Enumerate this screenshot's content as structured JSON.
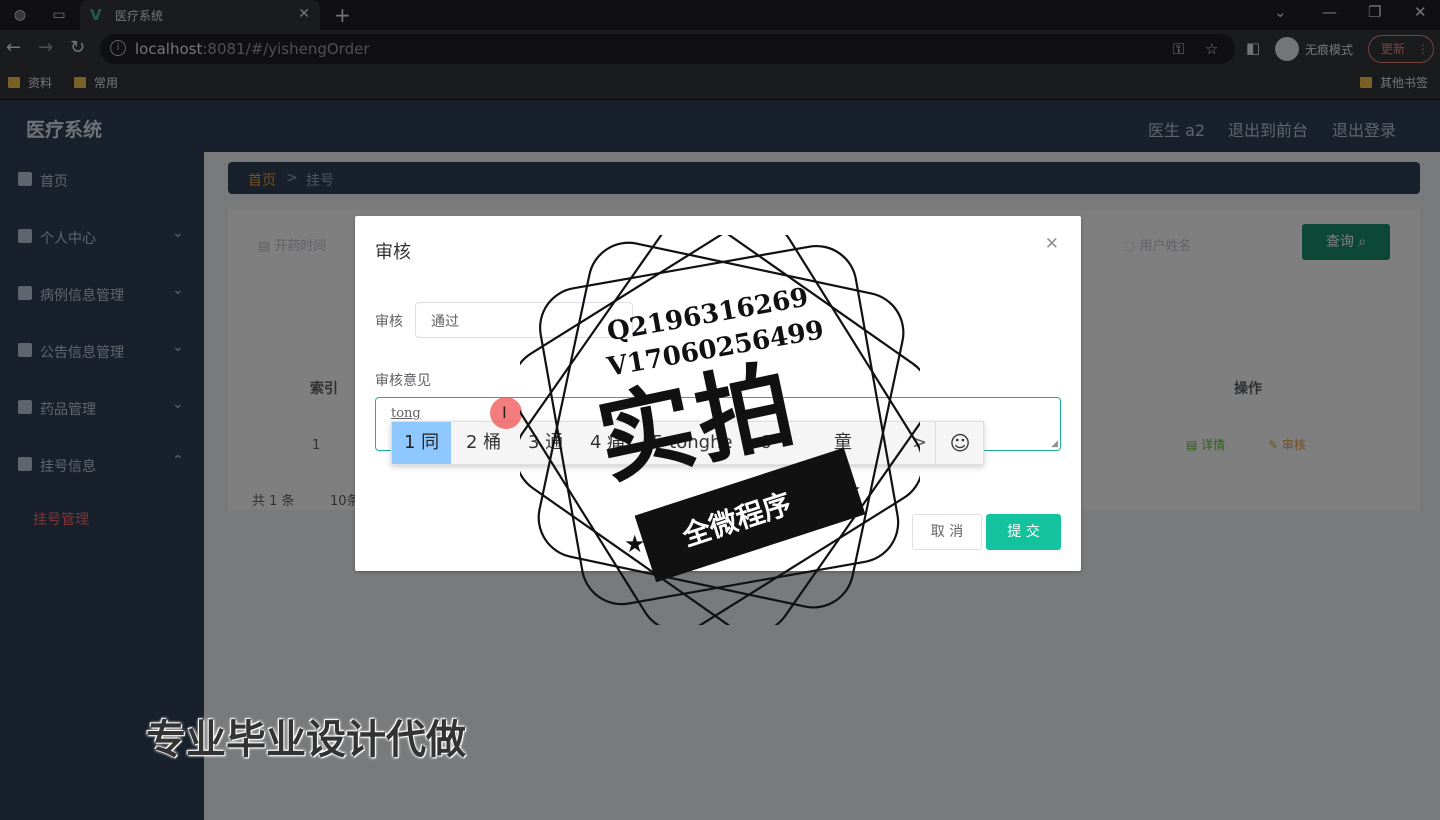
{
  "browser": {
    "tab_title": "医疗系统",
    "url_host": "localhost",
    "url_rest": ":8081/#/yishengOrder",
    "incognito_label": "无痕模式",
    "update_label": "更新",
    "bookmarks": [
      "资料",
      "常用"
    ],
    "other_bookmarks": "其他书签"
  },
  "app": {
    "title": "医疗系统",
    "header_links": [
      "医生 a2",
      "退出到前台",
      "退出登录"
    ],
    "sidebar": {
      "items": [
        {
          "label": "首页",
          "icon": "home-icon"
        },
        {
          "label": "个人中心",
          "icon": "user-icon"
        },
        {
          "label": "病例信息管理",
          "icon": "folder-icon"
        },
        {
          "label": "公告信息管理",
          "icon": "notice-icon"
        },
        {
          "label": "药品管理",
          "icon": "pill-icon"
        },
        {
          "label": "挂号信息",
          "icon": "calendar-icon"
        }
      ],
      "active_sub": "挂号管理"
    },
    "breadcrumb": {
      "home": "首页",
      "sep": ">",
      "current": "挂号"
    },
    "search": {
      "field1": "开药时间",
      "field2": "用户姓名",
      "query_label": "查询"
    },
    "table": {
      "headers": [
        "索引",
        "操作"
      ],
      "row_index": "1",
      "op_detail": "详情",
      "op_audit": "审核"
    },
    "pager": {
      "total": "共 1 条",
      "size": "10条"
    }
  },
  "dialog": {
    "title": "审核",
    "field_label": "审核",
    "field_value": "通过",
    "opinion_label": "审核意见",
    "opinion_value": "tong",
    "cancel_label": "取 消",
    "submit_label": "提 交"
  },
  "ime": {
    "candidates": [
      "1 同",
      "2 桶",
      "3 通",
      "4 痛",
      "5 tonghe",
      "6",
      "童"
    ],
    "next": ">",
    "emoji": "☺"
  },
  "watermark": {
    "contact1": "Q2196316269",
    "contact2": "V17060256499",
    "big": "实拍",
    "ribbon": "全微程序",
    "promo": "专业毕业设计代做"
  }
}
